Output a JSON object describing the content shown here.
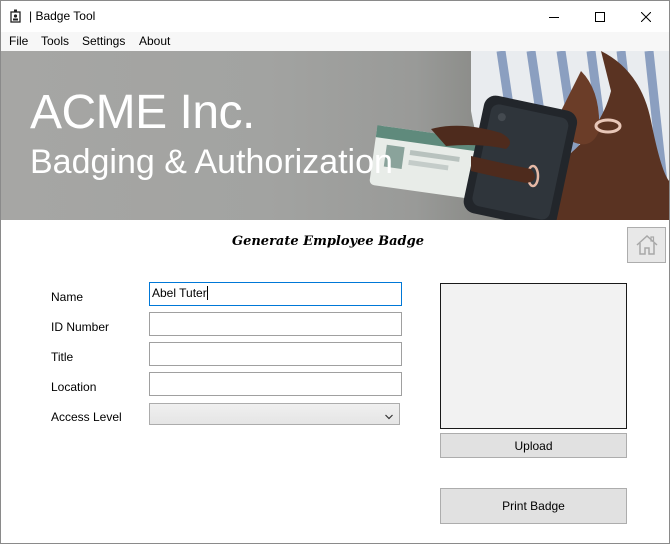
{
  "window": {
    "title": "| Badge Tool"
  },
  "menu": {
    "items": [
      "File",
      "Tools",
      "Settings",
      "About"
    ]
  },
  "banner": {
    "title": "ACME Inc.",
    "subtitle": "Badging & Authorization"
  },
  "form": {
    "heading": "Generate Employee Badge",
    "fields": {
      "name": {
        "label": "Name",
        "value": "Abel Tuter"
      },
      "id_number": {
        "label": "ID Number",
        "value": ""
      },
      "title": {
        "label": "Title",
        "value": ""
      },
      "location": {
        "label": "Location",
        "value": ""
      },
      "access_level": {
        "label": "Access Level",
        "selected": ""
      }
    }
  },
  "buttons": {
    "upload": "Upload",
    "print": "Print Badge"
  },
  "icons": {
    "app": "badge-icon",
    "minimize": "minimize-icon",
    "maximize": "maximize-icon",
    "close": "close-icon",
    "home": "home-icon",
    "dropdown": "chevron-down-icon"
  },
  "colors": {
    "focus_border": "#0078d7",
    "button_face": "#e1e1e1",
    "banner_text": "#ffffff"
  }
}
